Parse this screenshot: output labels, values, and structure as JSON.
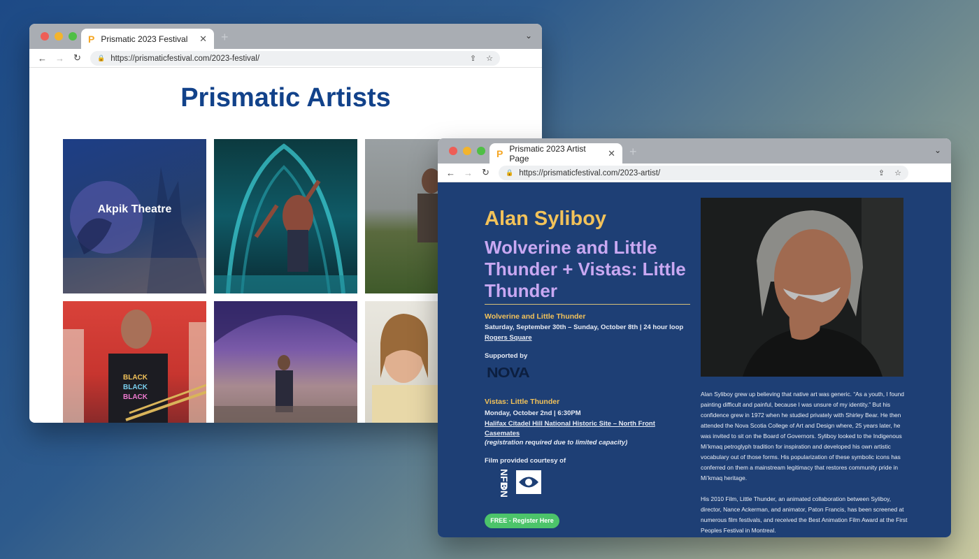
{
  "window1": {
    "tab_title": "Prismatic 2023 Festival",
    "url": "https://prismaticfestival.com/2023-festival/",
    "page_title": "Prismatic Artists",
    "tiles": [
      {
        "label": "Akpik Theatre",
        "photo": "akpik-theatre-image"
      },
      {
        "label": "",
        "photo": "dancer-image"
      },
      {
        "label": "",
        "photo": "field-musicians-image"
      },
      {
        "label": "",
        "photo": "trombone-player-image"
      },
      {
        "label": "",
        "photo": "violinist-image"
      },
      {
        "label": "",
        "photo": "portrait-man-image"
      }
    ]
  },
  "window2": {
    "tab_title": "Prismatic 2023 Artist Page",
    "url": "https://prismaticfestival.com/2023-artist/",
    "artist_name": "Alan Syliboy",
    "work_title": "Wolverine and Little Thunder + Vistas: Little Thunder",
    "event1": {
      "title": "Wolverine and Little Thunder",
      "dates": "Saturday, September 30th – Sunday, October 8th | 24 hour loop",
      "location": "Rogers Square"
    },
    "supported_by": "Supported by",
    "sponsor_logo_text": "NOVA",
    "event2": {
      "title": "Vistas: Little Thunder",
      "date": "Monday, October 2nd | 6:30PM",
      "location_line1": "Halifax Citadel Hill National Historic Site – North Front",
      "location_line2": "Casemates",
      "note": "(registration required due to limited capacity)"
    },
    "film_courtesy": "Film provided courtesy of",
    "register_button": "FREE - Register Here",
    "bio_paragraph1": "Alan Syliboy grew up believing that native art was generic. “As a youth, I found painting difficult and painful, because I was unsure of my identity.” But his confidence grew in 1972 when he studied privately with Shirley Bear. He then attended the Nova Scotia College of Art and Design where, 25 years later, he was invited to sit on the Board of Governors. Syliboy looked to the Indigenous Mi’kmaq petroglyph tradition for inspiration and developed his own artistic vocabulary out of those forms. His popularization of these symbolic icons has conferred on them a mainstream legitimacy that restores community pride in Mi’kmaq heritage.",
    "bio_paragraph2": "His 2010 Film, Little Thunder, an animated collaboration between Syliboy, director, Nance Ackerman, and animator, Paton Francis, has been screened at numerous film festivals, and received the Best Animation Film Award at the First Peoples Festival in Montreal."
  },
  "colors": {
    "brand_blue": "#12428a",
    "artist_page_bg": "#1e3f75",
    "accent_gold": "#f2c25a",
    "accent_lavender": "#c9a8f2",
    "register_green": "#4cc46a"
  }
}
